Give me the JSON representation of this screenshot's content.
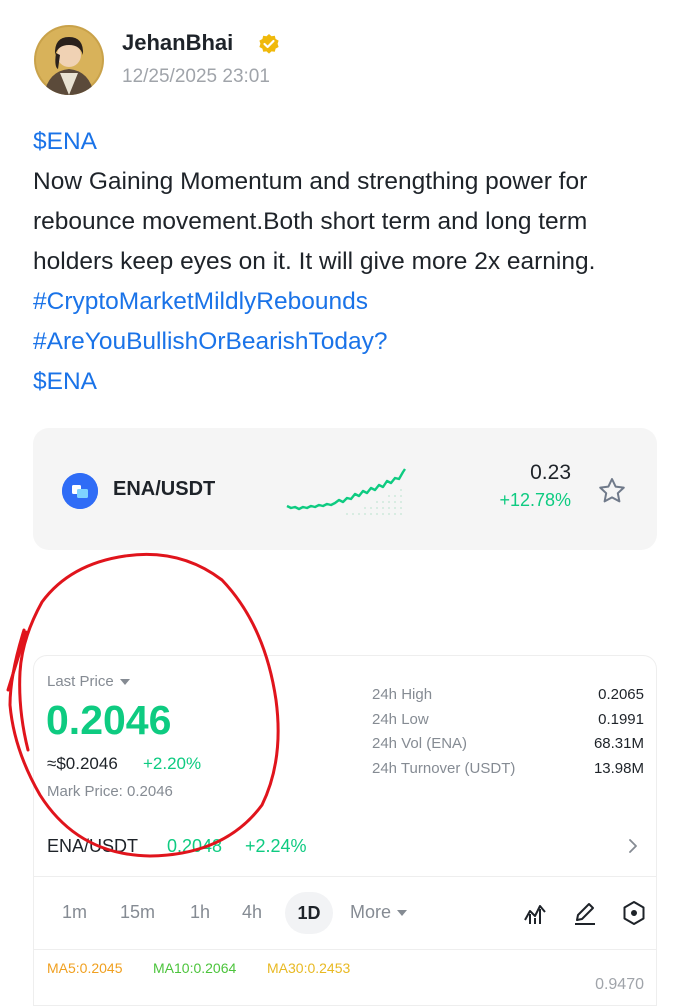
{
  "post": {
    "author": "JehanBhai",
    "timestamp": "12/25/2025 23:01",
    "lines": [
      {
        "text": "$ENA",
        "link": true
      },
      {
        "text": "Now Gaining Momentum and strengthing power for",
        "link": false
      },
      {
        "text": "rebounce movement.Both short term and long term",
        "link": false
      },
      {
        "text": "holders keep eyes on it. It will give more 2x earning.",
        "link": false
      },
      {
        "text": "#CryptoMarketMildlyRebounds",
        "link": true
      },
      {
        "text": "#AreYouBullishOrBearishToday?",
        "link": true
      },
      {
        "text": "$ENA",
        "link": true
      }
    ]
  },
  "ticker_card": {
    "pair": "ENA/USDT",
    "price": "0.23",
    "change": "+12.78%"
  },
  "market": {
    "last_price_label": "Last Price",
    "last_price": "0.2046",
    "approx_usd": "≈$0.2046",
    "approx_change": "+2.20%",
    "mark_price": "Mark Price:  0.2046",
    "stats": [
      {
        "label": "24h  High",
        "value": "0.2065"
      },
      {
        "label": "24h  Low",
        "value": "0.1991"
      },
      {
        "label": "24h  Vol (ENA)",
        "value": "68.31M"
      },
      {
        "label": "24h  Turnover (USDT)",
        "value": "13.98M"
      }
    ],
    "pair_line": {
      "pair": "ENA/USDT",
      "price": "0.2048",
      "change": "+2.24%"
    },
    "timeframes": [
      "1m",
      "15m",
      "1h",
      "4h",
      "1D",
      "More"
    ],
    "active_timeframe": "1D",
    "ma": [
      {
        "text": "MA5:0.2045",
        "color": "#f0a020"
      },
      {
        "text": "MA10:0.2064",
        "color": "#4cc43c"
      },
      {
        "text": "MA30:0.2453",
        "color": "#e8b923"
      }
    ],
    "axis_value": "0.9470"
  },
  "colors": {
    "up_green": "#0ecb81",
    "link_blue": "#1a73e8",
    "annotation_red": "#e0141c",
    "verified_gold": "#f0b90b"
  }
}
